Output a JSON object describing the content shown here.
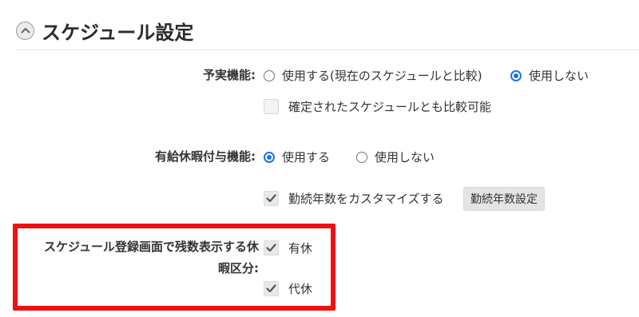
{
  "section": {
    "title": "スケジュール設定",
    "collapse_icon": "chevron-up-icon"
  },
  "plan_actual": {
    "label": "予実機能:",
    "options": [
      {
        "label": "使用する(現在のスケジュールと比較)",
        "selected": false
      },
      {
        "label": "使用しない",
        "selected": true
      }
    ],
    "compare_checkbox": {
      "label": "確定されたスケジュールとも比較可能",
      "checked": false,
      "disabled": true
    }
  },
  "paid_leave": {
    "label": "有給休暇付与機能:",
    "options": [
      {
        "label": "使用する",
        "selected": true
      },
      {
        "label": "使用しない",
        "selected": false
      }
    ],
    "customize_checkbox": {
      "label": "勤続年数をカスタマイズする",
      "checked": true
    },
    "settings_button": "勤続年数設定"
  },
  "remaining_display": {
    "label_line1": "スケジュール登録画面で残数表示する休",
    "label_line2": "暇区分:",
    "items": [
      {
        "label": "有休",
        "checked": true
      },
      {
        "label": "代休",
        "checked": true
      }
    ]
  },
  "colors": {
    "accent": "#1a73e8",
    "highlight": "#ee1111"
  }
}
